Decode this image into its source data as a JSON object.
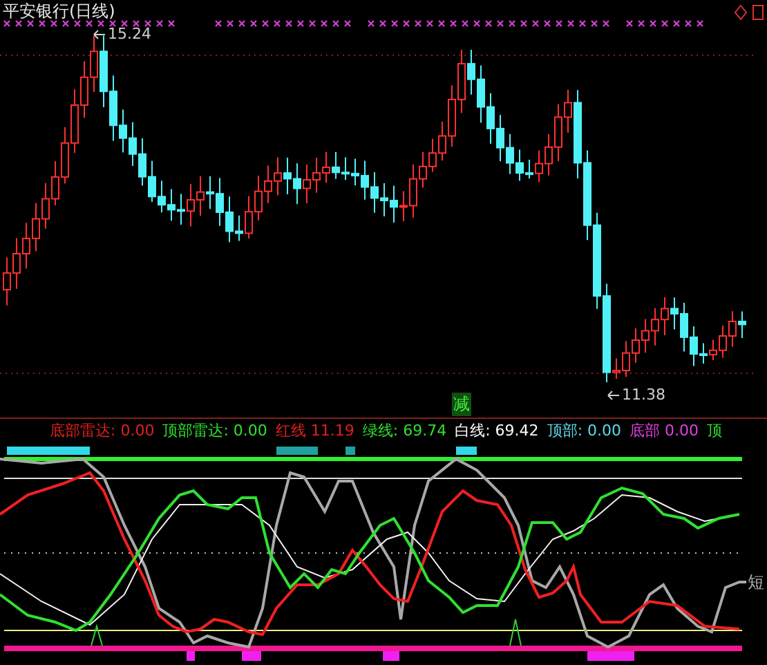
{
  "chart": {
    "title": "平安银行(日线)",
    "high_label": "15.24",
    "low_label": "11.38",
    "signal": "减"
  },
  "indicator": {
    "legend": [
      {
        "label": "底部雷达:",
        "value": "0.00",
        "color": "#e02020"
      },
      {
        "label": "顶部雷达:",
        "value": "0.00",
        "color": "#30e030"
      },
      {
        "label": "红线",
        "value": "11.19",
        "color": "#e02020"
      },
      {
        "label": "绿线:",
        "value": "69.74",
        "color": "#30e030"
      },
      {
        "label": "白线:",
        "value": "69.42",
        "color": "#ffffff"
      },
      {
        "label": "顶部:",
        "value": "0.00",
        "color": "#60d8e8"
      },
      {
        "label": "底部",
        "value": "0.00",
        "color": "#e040e0"
      },
      {
        "label": "顶",
        "color": "#30e030"
      }
    ],
    "side_label": "短"
  }
}
